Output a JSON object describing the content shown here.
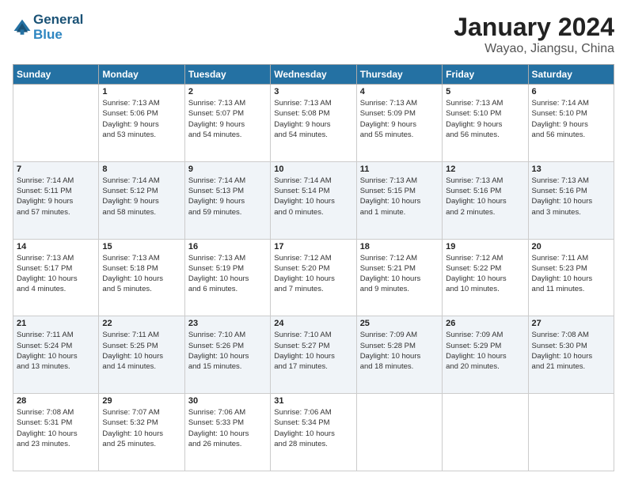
{
  "header": {
    "logo_line1": "General",
    "logo_line2": "Blue",
    "month": "January 2024",
    "location": "Wayao, Jiangsu, China"
  },
  "weekdays": [
    "Sunday",
    "Monday",
    "Tuesday",
    "Wednesday",
    "Thursday",
    "Friday",
    "Saturday"
  ],
  "weeks": [
    [
      {
        "day": "",
        "info": ""
      },
      {
        "day": "1",
        "info": "Sunrise: 7:13 AM\nSunset: 5:06 PM\nDaylight: 9 hours\nand 53 minutes."
      },
      {
        "day": "2",
        "info": "Sunrise: 7:13 AM\nSunset: 5:07 PM\nDaylight: 9 hours\nand 54 minutes."
      },
      {
        "day": "3",
        "info": "Sunrise: 7:13 AM\nSunset: 5:08 PM\nDaylight: 9 hours\nand 54 minutes."
      },
      {
        "day": "4",
        "info": "Sunrise: 7:13 AM\nSunset: 5:09 PM\nDaylight: 9 hours\nand 55 minutes."
      },
      {
        "day": "5",
        "info": "Sunrise: 7:13 AM\nSunset: 5:10 PM\nDaylight: 9 hours\nand 56 minutes."
      },
      {
        "day": "6",
        "info": "Sunrise: 7:14 AM\nSunset: 5:10 PM\nDaylight: 9 hours\nand 56 minutes."
      }
    ],
    [
      {
        "day": "7",
        "info": "Sunrise: 7:14 AM\nSunset: 5:11 PM\nDaylight: 9 hours\nand 57 minutes."
      },
      {
        "day": "8",
        "info": "Sunrise: 7:14 AM\nSunset: 5:12 PM\nDaylight: 9 hours\nand 58 minutes."
      },
      {
        "day": "9",
        "info": "Sunrise: 7:14 AM\nSunset: 5:13 PM\nDaylight: 9 hours\nand 59 minutes."
      },
      {
        "day": "10",
        "info": "Sunrise: 7:14 AM\nSunset: 5:14 PM\nDaylight: 10 hours\nand 0 minutes."
      },
      {
        "day": "11",
        "info": "Sunrise: 7:13 AM\nSunset: 5:15 PM\nDaylight: 10 hours\nand 1 minute."
      },
      {
        "day": "12",
        "info": "Sunrise: 7:13 AM\nSunset: 5:16 PM\nDaylight: 10 hours\nand 2 minutes."
      },
      {
        "day": "13",
        "info": "Sunrise: 7:13 AM\nSunset: 5:16 PM\nDaylight: 10 hours\nand 3 minutes."
      }
    ],
    [
      {
        "day": "14",
        "info": "Sunrise: 7:13 AM\nSunset: 5:17 PM\nDaylight: 10 hours\nand 4 minutes."
      },
      {
        "day": "15",
        "info": "Sunrise: 7:13 AM\nSunset: 5:18 PM\nDaylight: 10 hours\nand 5 minutes."
      },
      {
        "day": "16",
        "info": "Sunrise: 7:13 AM\nSunset: 5:19 PM\nDaylight: 10 hours\nand 6 minutes."
      },
      {
        "day": "17",
        "info": "Sunrise: 7:12 AM\nSunset: 5:20 PM\nDaylight: 10 hours\nand 7 minutes."
      },
      {
        "day": "18",
        "info": "Sunrise: 7:12 AM\nSunset: 5:21 PM\nDaylight: 10 hours\nand 9 minutes."
      },
      {
        "day": "19",
        "info": "Sunrise: 7:12 AM\nSunset: 5:22 PM\nDaylight: 10 hours\nand 10 minutes."
      },
      {
        "day": "20",
        "info": "Sunrise: 7:11 AM\nSunset: 5:23 PM\nDaylight: 10 hours\nand 11 minutes."
      }
    ],
    [
      {
        "day": "21",
        "info": "Sunrise: 7:11 AM\nSunset: 5:24 PM\nDaylight: 10 hours\nand 13 minutes."
      },
      {
        "day": "22",
        "info": "Sunrise: 7:11 AM\nSunset: 5:25 PM\nDaylight: 10 hours\nand 14 minutes."
      },
      {
        "day": "23",
        "info": "Sunrise: 7:10 AM\nSunset: 5:26 PM\nDaylight: 10 hours\nand 15 minutes."
      },
      {
        "day": "24",
        "info": "Sunrise: 7:10 AM\nSunset: 5:27 PM\nDaylight: 10 hours\nand 17 minutes."
      },
      {
        "day": "25",
        "info": "Sunrise: 7:09 AM\nSunset: 5:28 PM\nDaylight: 10 hours\nand 18 minutes."
      },
      {
        "day": "26",
        "info": "Sunrise: 7:09 AM\nSunset: 5:29 PM\nDaylight: 10 hours\nand 20 minutes."
      },
      {
        "day": "27",
        "info": "Sunrise: 7:08 AM\nSunset: 5:30 PM\nDaylight: 10 hours\nand 21 minutes."
      }
    ],
    [
      {
        "day": "28",
        "info": "Sunrise: 7:08 AM\nSunset: 5:31 PM\nDaylight: 10 hours\nand 23 minutes."
      },
      {
        "day": "29",
        "info": "Sunrise: 7:07 AM\nSunset: 5:32 PM\nDaylight: 10 hours\nand 25 minutes."
      },
      {
        "day": "30",
        "info": "Sunrise: 7:06 AM\nSunset: 5:33 PM\nDaylight: 10 hours\nand 26 minutes."
      },
      {
        "day": "31",
        "info": "Sunrise: 7:06 AM\nSunset: 5:34 PM\nDaylight: 10 hours\nand 28 minutes."
      },
      {
        "day": "",
        "info": ""
      },
      {
        "day": "",
        "info": ""
      },
      {
        "day": "",
        "info": ""
      }
    ]
  ]
}
